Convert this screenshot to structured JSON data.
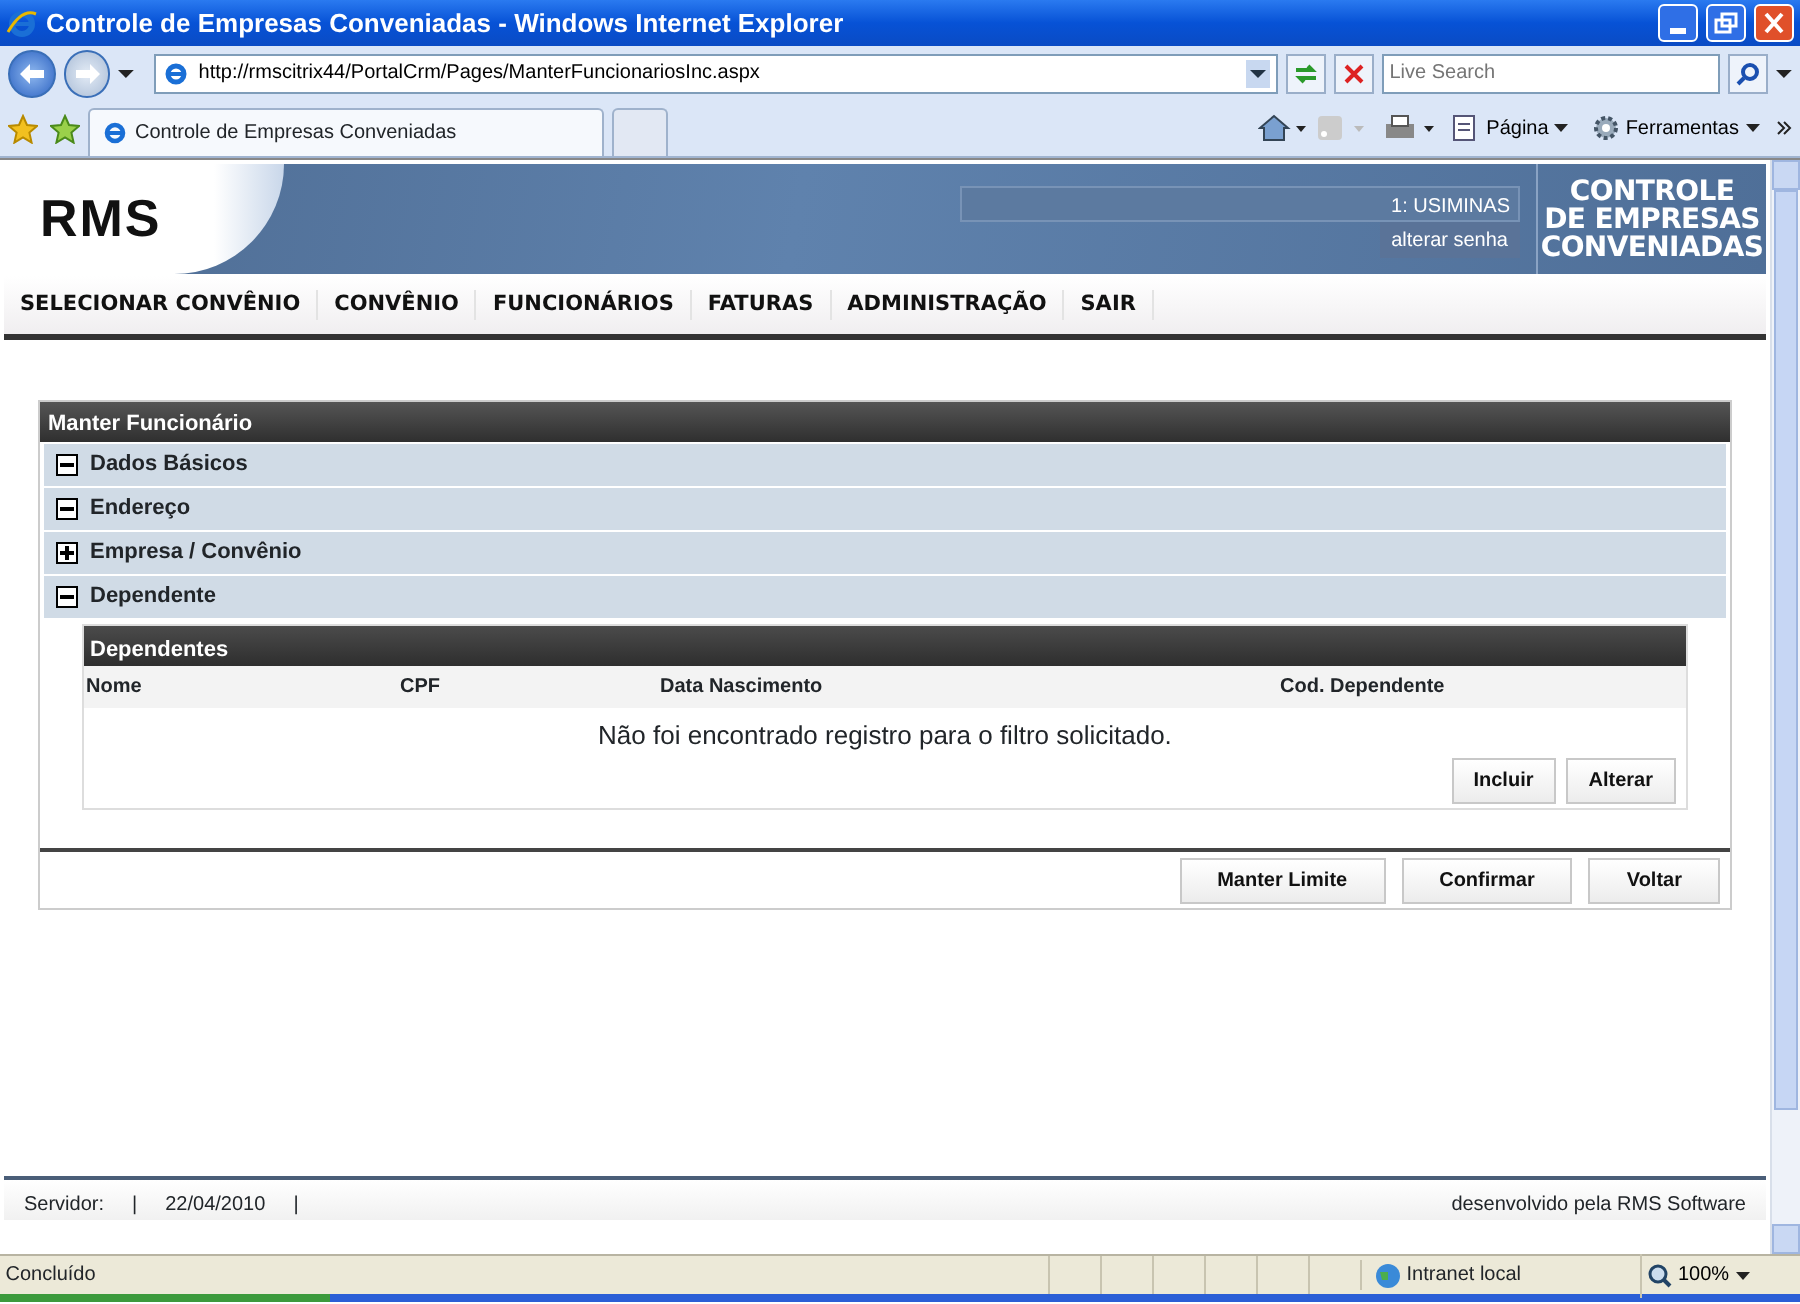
{
  "window": {
    "title": "Controle de Empresas Conveniadas - Windows Internet Explorer"
  },
  "address_bar": {
    "url": "http://rmscitrix44/PortalCrm/Pages/ManterFuncionariosInc.aspx",
    "search_placeholder": "Live Search"
  },
  "tabs": [
    {
      "label": "Controle de Empresas Conveniadas",
      "selected": true
    }
  ],
  "command_bar": [
    {
      "label": "Página",
      "kind": "page"
    },
    {
      "label": "Ferramentas",
      "kind": "tools"
    }
  ],
  "header": {
    "logo": "RMS",
    "user": "1: USIMINAS",
    "change_password": "alterar senha",
    "title_lines": [
      "CONTROLE",
      "DE EMPRESAS",
      "CONVENIADAS"
    ]
  },
  "menu": [
    "SELECIONAR CONVÊNIO",
    "CONVÊNIO",
    "FUNCIONÁRIOS",
    "FATURAS",
    "ADMINISTRAÇÃO",
    "SAIR"
  ],
  "panel": {
    "title": "Manter Funcionário",
    "sections": [
      {
        "label": "Dados Básicos",
        "expanded": true
      },
      {
        "label": "Endereço",
        "expanded": true
      },
      {
        "label": "Empresa / Convênio",
        "expanded": false
      },
      {
        "label": "Dependente",
        "expanded": true
      }
    ],
    "grid": {
      "title": "Dependentes",
      "columns": [
        "Nome",
        "CPF",
        "Data Nascimento",
        "Cod. Dependente"
      ],
      "empty_message": "Não foi encontrado registro para o filtro solicitado.",
      "buttons": [
        "Incluir",
        "Alterar"
      ]
    },
    "buttons": [
      "Manter Limite",
      "Confirmar",
      "Voltar"
    ]
  },
  "footer": {
    "left_items": [
      "Servidor:",
      "|",
      "22/04/2010",
      "|"
    ],
    "credit": "desenvolvido pela RMS Software"
  },
  "status_bar": {
    "text": "Concluído",
    "zone": "Intranet local",
    "zoom": "100%"
  }
}
